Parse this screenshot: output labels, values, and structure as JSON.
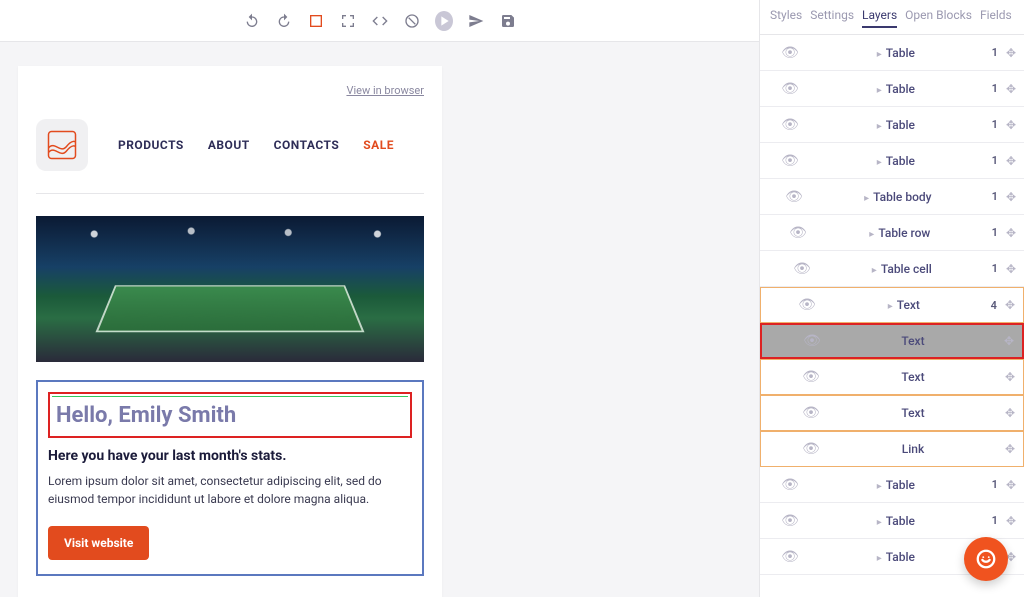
{
  "sidebar": {
    "tabs": [
      "Styles",
      "Settings",
      "Layers",
      "Open Blocks",
      "Fields"
    ],
    "activeTabIndex": 2,
    "layers": [
      {
        "label": "Table",
        "indent": 3,
        "caret": true,
        "count": "1",
        "state": "normal"
      },
      {
        "label": "Table",
        "indent": 3,
        "caret": true,
        "count": "1",
        "state": "normal"
      },
      {
        "label": "Table",
        "indent": 3,
        "caret": true,
        "count": "1",
        "state": "normal"
      },
      {
        "label": "Table",
        "indent": 3,
        "caret": true,
        "count": "1",
        "state": "normal"
      },
      {
        "label": "Table body",
        "indent": 4,
        "caret": true,
        "count": "1",
        "state": "normal"
      },
      {
        "label": "Table row",
        "indent": 5,
        "caret": true,
        "count": "1",
        "state": "normal"
      },
      {
        "label": "Table cell",
        "indent": 6,
        "caret": true,
        "count": "1",
        "state": "normal"
      },
      {
        "label": "Text",
        "indent": 7,
        "caret": true,
        "count": "4",
        "state": "highlight"
      },
      {
        "label": "Text",
        "indent": 8,
        "caret": false,
        "count": "",
        "state": "selected"
      },
      {
        "label": "Text",
        "indent": 8,
        "caret": false,
        "count": "",
        "state": "highlight"
      },
      {
        "label": "Text",
        "indent": 8,
        "caret": false,
        "count": "",
        "state": "highlight"
      },
      {
        "label": "Link",
        "indent": 8,
        "caret": false,
        "count": "",
        "state": "highlight"
      },
      {
        "label": "Table",
        "indent": 3,
        "caret": true,
        "count": "1",
        "state": "normal"
      },
      {
        "label": "Table",
        "indent": 3,
        "caret": true,
        "count": "1",
        "state": "normal"
      },
      {
        "label": "Table",
        "indent": 3,
        "caret": true,
        "count": "1",
        "state": "normal"
      }
    ]
  },
  "toolbar": {
    "icons": [
      "undo",
      "redo",
      "outline",
      "fullscreen",
      "code",
      "clear",
      "preview",
      "send",
      "save"
    ]
  },
  "email": {
    "view_in_browser": "View in browser",
    "nav": {
      "products": "PRODUCTS",
      "about": "ABOUT",
      "contacts": "CONTACTS",
      "sale": "SALE"
    },
    "hello": "Hello, Emily Smith",
    "subhead": "Here you have your last month's stats.",
    "body": "Lorem ipsum dolor sit amet, consectetur adipiscing elit, sed do eiusmod tempor incididunt ut labore et dolore magna aliqua.",
    "cta": "Visit website"
  }
}
